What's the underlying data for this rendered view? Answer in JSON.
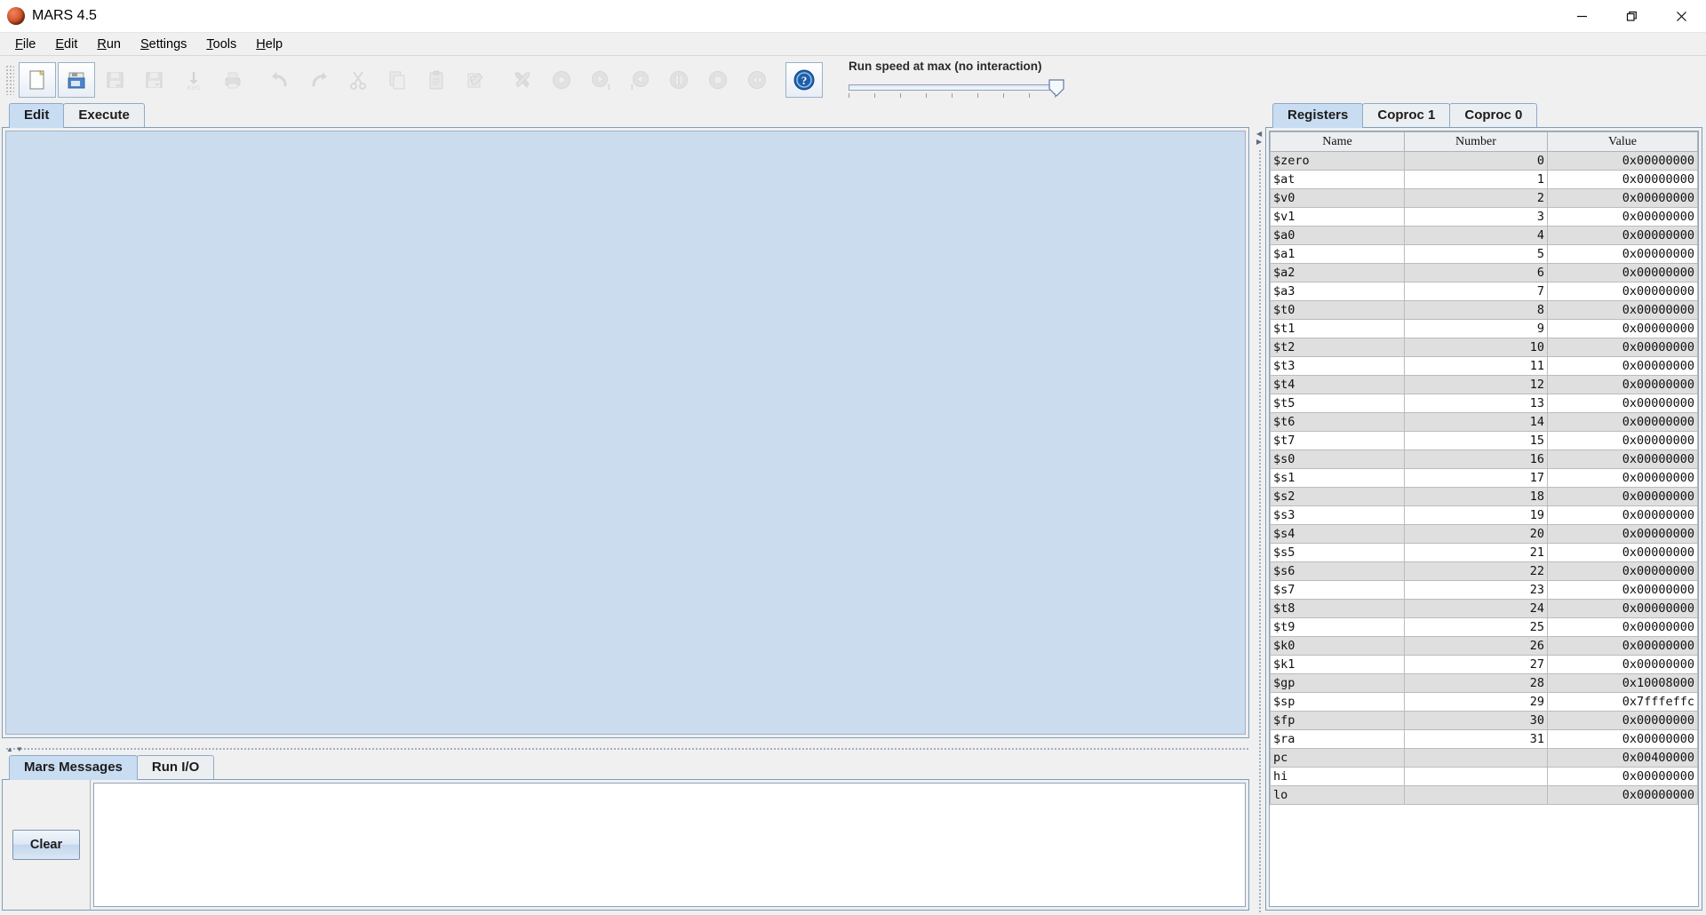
{
  "window": {
    "title": "MARS 4.5",
    "app_icon": "mars-planet-icon",
    "controls": {
      "minimize": "minimize-icon",
      "maximize": "maximize-icon",
      "close": "close-icon"
    }
  },
  "menubar": {
    "items": [
      {
        "label": "File",
        "mnemonic": "F"
      },
      {
        "label": "Edit",
        "mnemonic": "E"
      },
      {
        "label": "Run",
        "mnemonic": "R"
      },
      {
        "label": "Settings",
        "mnemonic": "S"
      },
      {
        "label": "Tools",
        "mnemonic": "T"
      },
      {
        "label": "Help",
        "mnemonic": "H"
      }
    ]
  },
  "toolbar": {
    "buttons": [
      {
        "name": "new-file-button",
        "icon": "new-document-icon",
        "enabled": true
      },
      {
        "name": "open-file-button",
        "icon": "open-folder-icon",
        "enabled": true
      },
      {
        "name": "save-file-button",
        "icon": "save-disk-icon",
        "enabled": false
      },
      {
        "name": "save-as-button",
        "icon": "save-as-icon",
        "enabled": false
      },
      {
        "name": "dump-memory-button",
        "icon": "dump-memory-icon",
        "enabled": false
      },
      {
        "name": "print-button",
        "icon": "printer-icon",
        "enabled": false
      },
      {
        "name": "undo-button",
        "icon": "undo-arrow-icon",
        "enabled": false
      },
      {
        "name": "redo-button",
        "icon": "redo-arrow-icon",
        "enabled": false
      },
      {
        "name": "cut-button",
        "icon": "scissors-icon",
        "enabled": false
      },
      {
        "name": "copy-button",
        "icon": "copy-pages-icon",
        "enabled": false
      },
      {
        "name": "paste-button",
        "icon": "clipboard-icon",
        "enabled": false
      },
      {
        "name": "find-replace-button",
        "icon": "find-replace-icon",
        "enabled": false
      },
      {
        "name": "assemble-button",
        "icon": "wrench-screwdriver-icon",
        "enabled": false
      },
      {
        "name": "run-button",
        "icon": "play-icon",
        "enabled": false
      },
      {
        "name": "step-button",
        "icon": "step-forward-icon",
        "enabled": false
      },
      {
        "name": "backstep-button",
        "icon": "step-backward-icon",
        "enabled": false
      },
      {
        "name": "pause-button",
        "icon": "pause-icon",
        "enabled": false
      },
      {
        "name": "stop-button",
        "icon": "stop-icon",
        "enabled": false
      },
      {
        "name": "reset-button",
        "icon": "rewind-icon",
        "enabled": false
      },
      {
        "name": "help-button",
        "icon": "question-mark-icon",
        "enabled": true
      }
    ],
    "run_speed": {
      "label": "Run speed at max (no interaction)",
      "value": 100,
      "min": 0,
      "max": 100,
      "tick_count": 9
    }
  },
  "editor": {
    "tabs": [
      {
        "label": "Edit",
        "active": true
      },
      {
        "label": "Execute",
        "active": false
      }
    ],
    "content": ""
  },
  "messages": {
    "tabs": [
      {
        "label": "Mars Messages",
        "active": true
      },
      {
        "label": "Run I/O",
        "active": false
      }
    ],
    "clear_label": "Clear",
    "content": ""
  },
  "registers": {
    "tabs": [
      {
        "label": "Registers",
        "active": true
      },
      {
        "label": "Coproc 1",
        "active": false
      },
      {
        "label": "Coproc 0",
        "active": false
      }
    ],
    "columns": [
      "Name",
      "Number",
      "Value"
    ],
    "rows": [
      {
        "name": "$zero",
        "number": "0",
        "value": "0x00000000"
      },
      {
        "name": "$at",
        "number": "1",
        "value": "0x00000000"
      },
      {
        "name": "$v0",
        "number": "2",
        "value": "0x00000000"
      },
      {
        "name": "$v1",
        "number": "3",
        "value": "0x00000000"
      },
      {
        "name": "$a0",
        "number": "4",
        "value": "0x00000000"
      },
      {
        "name": "$a1",
        "number": "5",
        "value": "0x00000000"
      },
      {
        "name": "$a2",
        "number": "6",
        "value": "0x00000000"
      },
      {
        "name": "$a3",
        "number": "7",
        "value": "0x00000000"
      },
      {
        "name": "$t0",
        "number": "8",
        "value": "0x00000000"
      },
      {
        "name": "$t1",
        "number": "9",
        "value": "0x00000000"
      },
      {
        "name": "$t2",
        "number": "10",
        "value": "0x00000000"
      },
      {
        "name": "$t3",
        "number": "11",
        "value": "0x00000000"
      },
      {
        "name": "$t4",
        "number": "12",
        "value": "0x00000000"
      },
      {
        "name": "$t5",
        "number": "13",
        "value": "0x00000000"
      },
      {
        "name": "$t6",
        "number": "14",
        "value": "0x00000000"
      },
      {
        "name": "$t7",
        "number": "15",
        "value": "0x00000000"
      },
      {
        "name": "$s0",
        "number": "16",
        "value": "0x00000000"
      },
      {
        "name": "$s1",
        "number": "17",
        "value": "0x00000000"
      },
      {
        "name": "$s2",
        "number": "18",
        "value": "0x00000000"
      },
      {
        "name": "$s3",
        "number": "19",
        "value": "0x00000000"
      },
      {
        "name": "$s4",
        "number": "20",
        "value": "0x00000000"
      },
      {
        "name": "$s5",
        "number": "21",
        "value": "0x00000000"
      },
      {
        "name": "$s6",
        "number": "22",
        "value": "0x00000000"
      },
      {
        "name": "$s7",
        "number": "23",
        "value": "0x00000000"
      },
      {
        "name": "$t8",
        "number": "24",
        "value": "0x00000000"
      },
      {
        "name": "$t9",
        "number": "25",
        "value": "0x00000000"
      },
      {
        "name": "$k0",
        "number": "26",
        "value": "0x00000000"
      },
      {
        "name": "$k1",
        "number": "27",
        "value": "0x00000000"
      },
      {
        "name": "$gp",
        "number": "28",
        "value": "0x10008000"
      },
      {
        "name": "$sp",
        "number": "29",
        "value": "0x7fffeffc"
      },
      {
        "name": "$fp",
        "number": "30",
        "value": "0x00000000"
      },
      {
        "name": "$ra",
        "number": "31",
        "value": "0x00000000"
      },
      {
        "name": "pc",
        "number": "",
        "value": "0x00400000"
      },
      {
        "name": "hi",
        "number": "",
        "value": "0x00000000"
      },
      {
        "name": "lo",
        "number": "",
        "value": "0x00000000"
      }
    ]
  },
  "colors": {
    "active_tab": "#c9ddf2",
    "editor_background": "#ccdcef",
    "panel_background": "#f0f0f0",
    "table_stripe": "#dfdfdf",
    "help_icon": "#1f5fa8"
  }
}
